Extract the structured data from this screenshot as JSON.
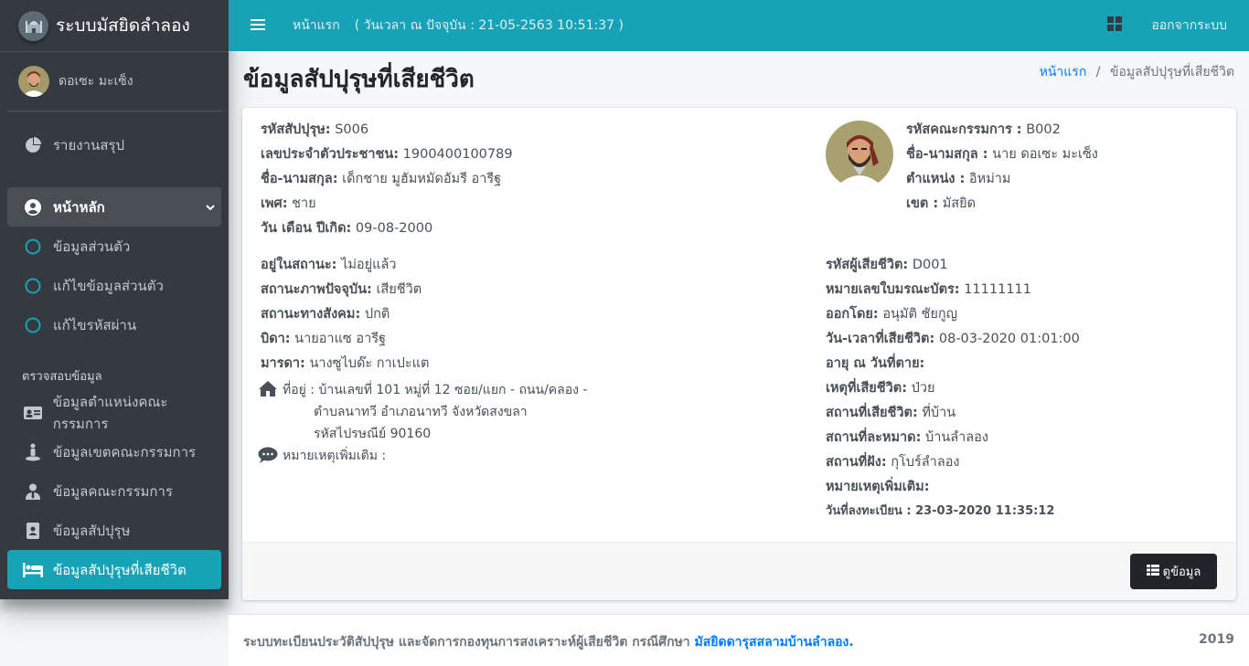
{
  "brand": {
    "name": "ระบบมัสยิดลำลอง"
  },
  "user": {
    "name": "ดอเซะ มะเซ็ง"
  },
  "sidebar": {
    "items": [
      {
        "label": "รายงานสรุป",
        "icon": "pie-chart-icon"
      },
      {
        "label": "หน้าหลัก",
        "icon": "user-circle-icon"
      },
      {
        "label": "ข้อมูลส่วนตัว",
        "icon": "circle-icon"
      },
      {
        "label": "แก้ไขข้อมูลส่วนตัว",
        "icon": "circle-icon"
      },
      {
        "label": "แก้ไขรหัสผ่าน",
        "icon": "circle-icon"
      }
    ],
    "header": "ตรวจสอบข้อมูล",
    "check_items": [
      {
        "label": "ข้อมูลตำแหน่งคณะกรรมการ",
        "icon": "id-card-icon"
      },
      {
        "label": "ข้อมูลเขตคณะกรรมการ",
        "icon": "street-view-icon"
      },
      {
        "label": "ข้อมูลคณะกรรมการ",
        "icon": "user-tie-icon"
      },
      {
        "label": "ข้อมูลสัปปุรุษ",
        "icon": "address-book-icon"
      },
      {
        "label": "ข้อมูลสัปปุรุษที่เสียชีวิต",
        "icon": "bed-icon"
      }
    ]
  },
  "navbar": {
    "home": "หน้าแรก",
    "time_label": "( วันเวลา ณ ปัจจุบัน : 21-05-2563 10:51:37 )",
    "logout": "ออกจากระบบ"
  },
  "page": {
    "title": "ข้อมูลสัปปุรุษที่เสียชีวิต",
    "breadcrumb_home": "หน้าแรก",
    "breadcrumb_sep": "/",
    "breadcrumb_current": "ข้อมูลสัปปุรุษที่เสียชีวิต"
  },
  "member": {
    "id_label": "รหัสสัปปุรุษ:",
    "id": "S006",
    "citizen_label": "เลขประจำตัวประชาชน:",
    "citizen": "1900400100789",
    "name_label": "ชื่อ-นามสกุล:",
    "name": "เด็กชาย มูฮัมหมัดอัมรี อารีฐ",
    "sex_label": "เพศ:",
    "sex": "ชาย",
    "birth_label": "วัน เดือน ปีเกิด:",
    "birth": "09-08-2000",
    "status_label": "อยู่ในสถานะ:",
    "status": "ไม่อยู่แล้ว",
    "current_label": "สถานะภาพปัจจุบัน:",
    "current": "เสียชีวิต",
    "social_label": "สถานะทางสังคม:",
    "social": "ปกติ",
    "father_label": "บิดา:",
    "father": "นายอาแซ อารีฐ",
    "mother_label": "มารดา:",
    "mother": "นางซูไบด๊ะ กาเปะแต",
    "address_line1": "ที่อยู่ : บ้านเลขที่ 101 หมู่ที่ 12 ซอย/แยก - ถนน/คลอง -",
    "address_line2": "ตำบลนาทวี อำเภอนาทวี จังหวัดสงขลา",
    "address_line3": "รหัสไปรษณีย์ 90160",
    "note_label": "หมายเหตุเพิ่มเติม :"
  },
  "committee": {
    "id_label": "รหัสคณะกรรมการ :",
    "id": "B002",
    "name_label": "ชื่อ-นามสกุล :",
    "name": "นาย ดอเซะ มะเซ็ง",
    "position_label": "ตำแหน่ง :",
    "position": "อิหม่าม",
    "zone_label": "เขต :",
    "zone": "มัสยิด"
  },
  "death": {
    "id_label": "รหัสผู้เสียชีวิต:",
    "id": "D001",
    "cert_label": "หมายเลขใบมรณะบัตร:",
    "cert": "11111111",
    "issued_label": "ออกโดย:",
    "issued": "อนุมัติ ชัยกูญ",
    "datetime_label": "วัน-เวลาที่เสียชีวิต:",
    "datetime": "08-03-2020 01:01:00",
    "age_label": "อายุ ณ วันที่ตาย:",
    "cause_label": "เหตุที่เสียชีวิต:",
    "cause": "ป่วย",
    "place_label": "สถานที่เสียชีวิต:",
    "place": "ที่บ้าน",
    "prayer_label": "สถานที่ละหมาด:",
    "prayer": "บ้านลำลอง",
    "burial_label": "สถานที่ฝัง:",
    "burial": "กุโบร์ลำลอง",
    "note_label": "หมายเหตุเพิ่มเติม:",
    "registered": "วันที่ลงทะเบียน : 23-03-2020 11:35:12"
  },
  "actions": {
    "view": "ดูข้อมูล"
  },
  "footer": {
    "text": "ระบบทะเบียนประวัติสัปปุรุษ และจัดการกองทุนการสงเคราะห์ผู้เสียชีวิต กรณีศึกษา ",
    "link": "มัสยิดดารุสสลามบ้านลำลอง.",
    "year": "2019"
  },
  "colors": {
    "navbar": "#17a2b8",
    "sidebar": "#343a40",
    "active": "#17a2b8",
    "link": "#007bff"
  }
}
